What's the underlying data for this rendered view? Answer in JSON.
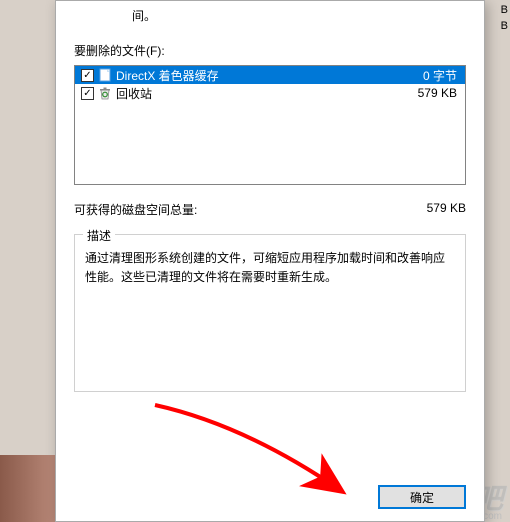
{
  "top_text_fragment": "间。",
  "files_label": "要删除的文件(F):",
  "files": [
    {
      "name": "DirectX 着色器缓存",
      "size": "0 字节",
      "checked": true,
      "selected": true,
      "icon": "doc"
    },
    {
      "name": "回收站",
      "size": "579 KB",
      "checked": true,
      "selected": false,
      "icon": "recycle"
    }
  ],
  "total_label": "可获得的磁盘空间总量:",
  "total_value": "579 KB",
  "description_label": "描述",
  "description_text": "通过清理图形系统创建的文件，可缩短应用程序加载时间和改善响应性能。这些已清理的文件将在需要时重新生成。",
  "ok_button": "确定",
  "watermark": "下载吧",
  "watermark_sub": "www.xiazaiba.com",
  "outer_sizes": [
    "B",
    "B"
  ]
}
